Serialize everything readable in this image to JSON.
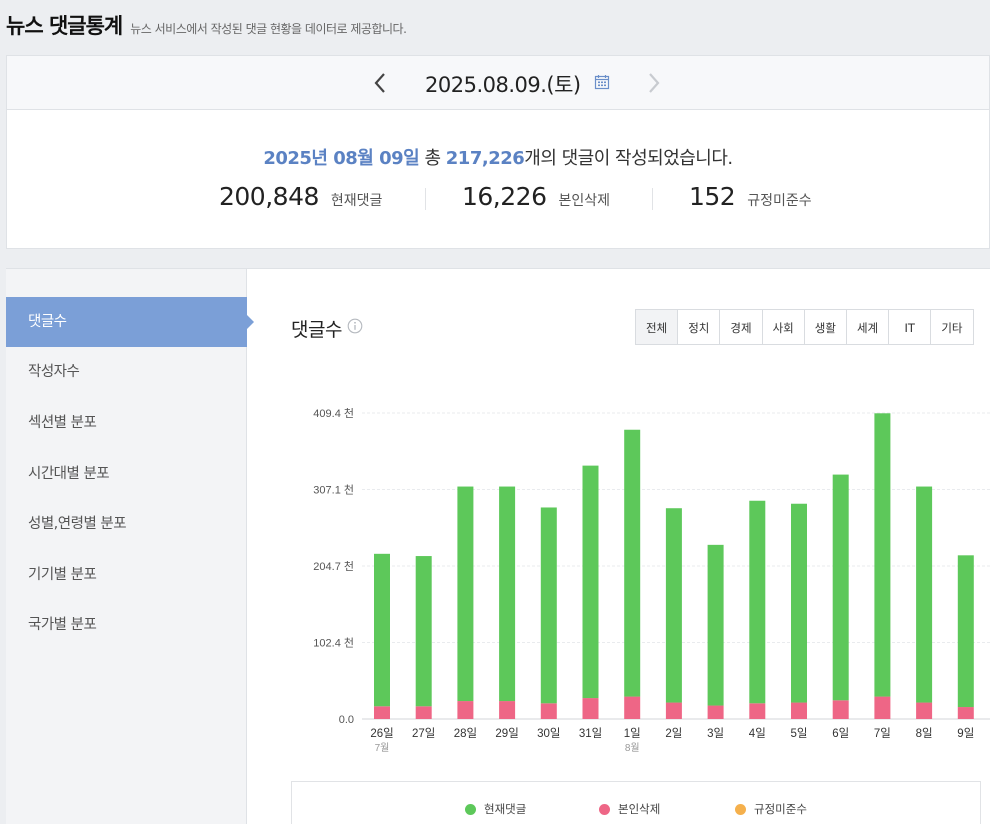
{
  "header": {
    "title": "뉴스 댓글통계",
    "description": "뉴스 서비스에서 작성된 댓글 현황을 데이터로 제공합니다."
  },
  "date_bar": {
    "date": "2025.08.09.(토)",
    "prev_icon": "chevron-left-icon",
    "next_icon": "chevron-right-icon",
    "calendar_icon": "calendar-icon"
  },
  "summary": {
    "date_text": "2025년 08월 09일",
    "prefix": "총",
    "total": "217,226",
    "suffix": "개의 댓글이 작성되었습니다.",
    "stats": [
      {
        "value": "200,848",
        "label": "현재댓글"
      },
      {
        "value": "16,226",
        "label": "본인삭제"
      },
      {
        "value": "152",
        "label": "규정미준수"
      }
    ]
  },
  "sidebar": {
    "items": [
      {
        "label": "댓글수",
        "active": true
      },
      {
        "label": "작성자수",
        "active": false
      },
      {
        "label": "섹션별 분포",
        "active": false
      },
      {
        "label": "시간대별 분포",
        "active": false
      },
      {
        "label": "성별,연령별 분포",
        "active": false
      },
      {
        "label": "기기별 분포",
        "active": false
      },
      {
        "label": "국가별 분포",
        "active": false
      }
    ]
  },
  "main": {
    "title": "댓글수",
    "info_icon": "info-icon",
    "tabs": [
      {
        "label": "전체",
        "active": true
      },
      {
        "label": "정치",
        "active": false
      },
      {
        "label": "경제",
        "active": false
      },
      {
        "label": "사회",
        "active": false
      },
      {
        "label": "생활",
        "active": false
      },
      {
        "label": "세계",
        "active": false
      },
      {
        "label": "IT",
        "active": false
      },
      {
        "label": "기타",
        "active": false
      }
    ]
  },
  "colors": {
    "current": "#5dc85a",
    "deleted": "#ee6686",
    "violation": "#f5b04c",
    "accent": "#7b9fd7"
  },
  "chart_data": {
    "type": "bar",
    "stacked": true,
    "grid": true,
    "legend_position": "bottom",
    "ylim": [
      0,
      409400
    ],
    "yticks": [
      {
        "value": 0,
        "label": "0.0"
      },
      {
        "value": 102350,
        "label": "102.4 천"
      },
      {
        "value": 204700,
        "label": "204.7 천"
      },
      {
        "value": 307050,
        "label": "307.1 천"
      },
      {
        "value": 409400,
        "label": "409.4 천"
      }
    ],
    "categories": [
      "26일",
      "27일",
      "28일",
      "29일",
      "30일",
      "31일",
      "1일",
      "2일",
      "3일",
      "4일",
      "5일",
      "6일",
      "7일",
      "8일",
      "9일"
    ],
    "sublabels": [
      "7월",
      "",
      "",
      "",
      "",
      "",
      "8월",
      "",
      "",
      "",
      "",
      "",
      "",
      "",
      ""
    ],
    "series": [
      {
        "name": "본인삭제",
        "color": "#ee6686",
        "values": [
          17000,
          17000,
          24000,
          24000,
          21000,
          28000,
          30000,
          22000,
          18000,
          21000,
          22000,
          25000,
          30000,
          22000,
          16000
        ]
      },
      {
        "name": "현재댓글",
        "color": "#5dc85a",
        "values": [
          204000,
          201000,
          287000,
          287000,
          262000,
          311000,
          357000,
          260000,
          215000,
          271000,
          266000,
          302000,
          379000,
          289000,
          203000
        ]
      },
      {
        "name": "규정미준수",
        "color": "#f5b04c",
        "values": [
          150,
          150,
          200,
          200,
          180,
          220,
          250,
          180,
          160,
          190,
          190,
          210,
          260,
          200,
          152
        ]
      }
    ],
    "legend": [
      "현재댓글",
      "본인삭제",
      "규정미준수"
    ]
  }
}
